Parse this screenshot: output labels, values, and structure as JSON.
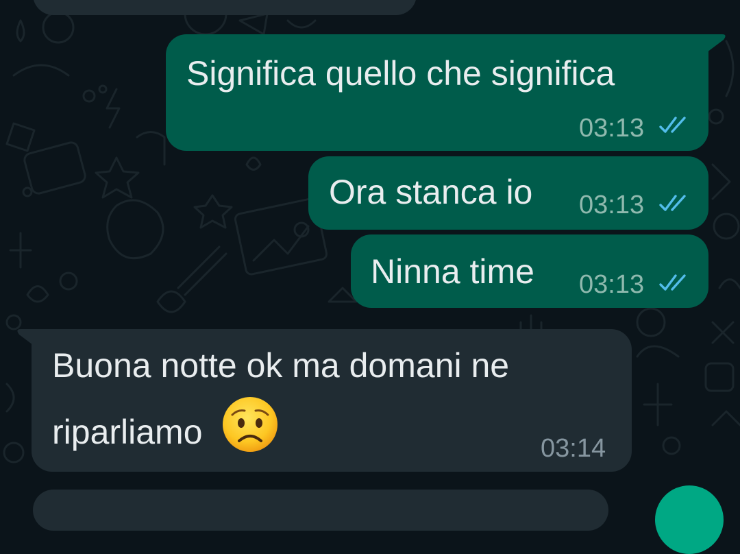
{
  "colors": {
    "background": "#0b141a",
    "outgoing_bubble": "#005c4b",
    "incoming_bubble": "#202c33",
    "read_ticks": "#53bdeb",
    "text": "#e9edef",
    "fab": "#00a884"
  },
  "messages": [
    {
      "direction": "outgoing",
      "text": "Significa quello che significa",
      "time": "03:13",
      "status": "read",
      "status_icon": "double-check-icon"
    },
    {
      "direction": "outgoing",
      "text": "Ora stanca io",
      "time": "03:13",
      "status": "read",
      "status_icon": "double-check-icon"
    },
    {
      "direction": "outgoing",
      "text": "Ninna time",
      "time": "03:13",
      "status": "read",
      "status_icon": "double-check-icon"
    },
    {
      "direction": "incoming",
      "lines": [
        "Buona notte ok ma domani ne",
        "riparliamo"
      ],
      "emoji": "worried-face-emoji",
      "time": "03:14"
    }
  ]
}
